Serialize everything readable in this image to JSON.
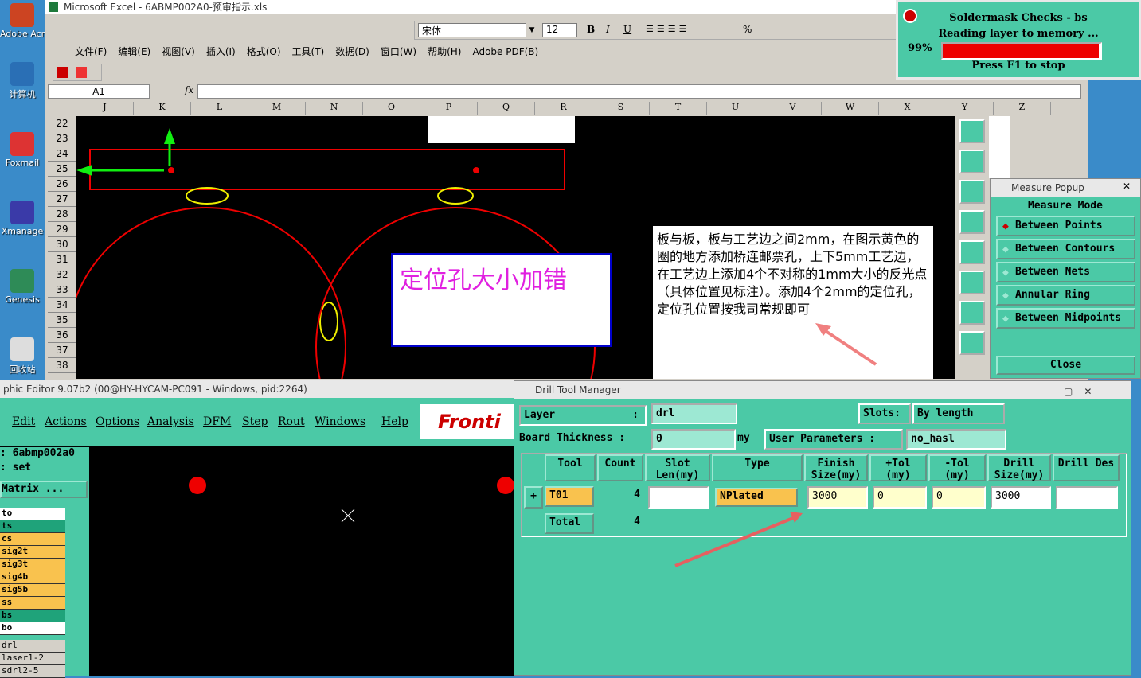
{
  "desktop": {
    "icons": [
      {
        "label": "Adobe Acrobat",
        "name": "adobe-acrobat-icon"
      },
      {
        "label": "计算机",
        "name": "computer-icon"
      },
      {
        "label": "Foxmail",
        "name": "foxmail-icon"
      },
      {
        "label": "Xmanage",
        "name": "xmanager-icon"
      },
      {
        "label": "Genesis",
        "name": "genesis-icon"
      },
      {
        "label": "回收站",
        "name": "recycle-bin-icon"
      }
    ]
  },
  "excel": {
    "title": "Microsoft Excel - 6ABMP002A0-预审指示.xls",
    "font_name": "宋体",
    "font_size": "12",
    "menu": [
      "文件(F)",
      "编辑(E)",
      "视图(V)",
      "插入(I)",
      "格式(O)",
      "工具(T)",
      "数据(D)",
      "窗口(W)",
      "帮助(H)",
      "Adobe PDF(B)"
    ],
    "name_box": "A1",
    "fx": "fx",
    "columns": [
      "J",
      "K",
      "L",
      "M",
      "N",
      "O",
      "P",
      "Q",
      "R",
      "S",
      "T",
      "U",
      "V",
      "W",
      "X",
      "Y",
      "Z"
    ],
    "rows": [
      "22",
      "23",
      "24",
      "25",
      "26",
      "27",
      "28",
      "29",
      "30",
      "31",
      "32",
      "33",
      "34",
      "35",
      "36",
      "37",
      "38"
    ],
    "pink_note": "定位孔大小加错",
    "instructions": "板与板，板与工艺边之间2mm，在图示黄色的圈的地方添加桥连邮票孔，上下5mm工艺边，在工艺边上添加4个不对称的1mm大小的反光点（具体位置见标注）。添加4个2mm的定位孔，定位孔位置按我司常规即可"
  },
  "soldermask": {
    "title": "Soldermask Checks - bs",
    "status": "Reading layer to memory ...",
    "percent": "99%",
    "progress": 0.99,
    "hint": "Press F1 to stop"
  },
  "measure": {
    "title": "Measure Popup",
    "header": "Measure Mode",
    "items": [
      "Between Points",
      "Between Contours",
      "Between Nets",
      "Annular Ring",
      "Between Midpoints"
    ],
    "close": "Close"
  },
  "genesis": {
    "title": "phic Editor 9.07b2 (00@HY-HYCAM-PC091 - Windows, pid:2264)",
    "menu": [
      "Edit",
      "Actions",
      "Options",
      "Analysis",
      "DFM",
      "Step",
      "Rout",
      "Windows",
      "Help"
    ],
    "logo": "Fronti",
    "job": ": 6abmp002a0",
    "step": ": set",
    "matrix": "Matrix ...",
    "layers": [
      {
        "name": "to",
        "color": "#ffffff"
      },
      {
        "name": "ts",
        "color": "#1fa37a"
      },
      {
        "name": "cs",
        "color": "#f9c24e"
      },
      {
        "name": "sig2t",
        "color": "#f9c24e"
      },
      {
        "name": "sig3t",
        "color": "#f9c24e"
      },
      {
        "name": "sig4b",
        "color": "#f9c24e"
      },
      {
        "name": "sig5b",
        "color": "#f9c24e"
      },
      {
        "name": "ss",
        "color": "#f9c24e"
      },
      {
        "name": "bs",
        "color": "#1fa37a"
      },
      {
        "name": "bo",
        "color": "#ffffff"
      }
    ],
    "drill_layers": [
      "drl",
      "laser1-2",
      "sdrl2-5"
    ]
  },
  "drill": {
    "title": "Drill Tool Manager",
    "layer_label": "Layer",
    "layer_value": "drl",
    "slots_label": "Slots:",
    "slots_value": "By length",
    "thickness_label": "Board Thickness :",
    "thickness_value": "0",
    "thickness_unit": "my",
    "user_params_label": "User Parameters :",
    "user_params_value": "no_hasl",
    "headers": [
      "Tool",
      "Count",
      "Slot Len(my)",
      "Type",
      "Finish Size(my)",
      "+Tol (my)",
      "-Tol (my)",
      "Drill Size(my)",
      "Drill Des"
    ],
    "row": {
      "tool": "T01",
      "count": "4",
      "type": "NPlated",
      "finish": "3000",
      "ptol": "0",
      "ntol": "0",
      "drill": "3000"
    },
    "total_label": "Total",
    "total_count": "4"
  }
}
